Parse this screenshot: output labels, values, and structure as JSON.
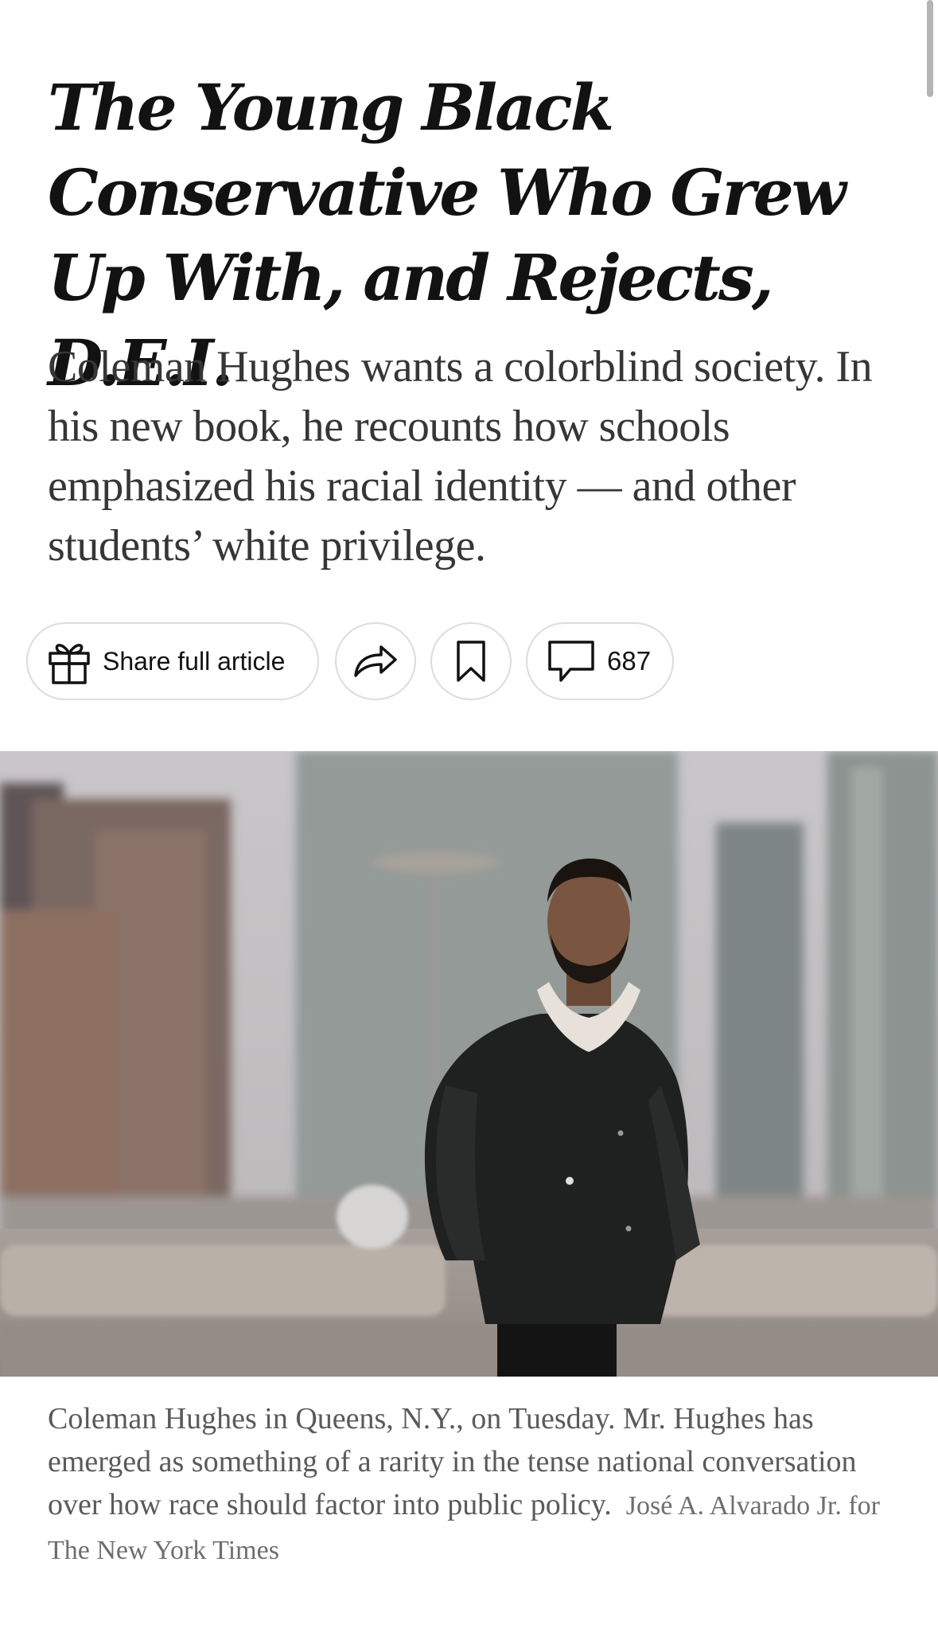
{
  "article": {
    "headline": "The Young Black Conservative Who Grew Up With, and Rejects, D.E.I.",
    "summary": "Coleman Hughes wants a colorblind society. In his new book, he recounts how schools emphasized his racial identity — and other students’ white privilege.",
    "actions": {
      "gift_label": "Share full article",
      "gift_icon": "gift-icon",
      "share_icon": "share-arrow-icon",
      "save_icon": "bookmark-icon",
      "comments_icon": "comment-bubble-icon",
      "comments_count": "687"
    },
    "image": {
      "caption": "Coleman Hughes in Queens, N.Y., on Tuesday. Mr. Hughes has emerged as something of a rarity in the tense national conversation over how race should factor into public policy.",
      "credit": "José A. Alvarado Jr. for The New York Times"
    }
  },
  "colors": {
    "headline": "#121212",
    "summary": "#363636",
    "caption": "#5a5a5a",
    "pill_border": "#dcdcdc"
  }
}
